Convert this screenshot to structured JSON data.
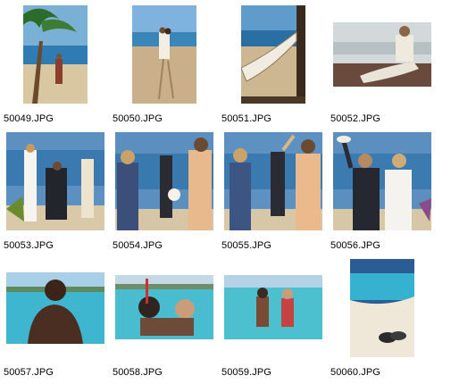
{
  "thumbnails": [
    {
      "filename": "50049.JPG",
      "icon": "palm-tree-beach-couple-photo"
    },
    {
      "filename": "50050.JPG",
      "icon": "couple-walking-beach-photo"
    },
    {
      "filename": "50051.JPG",
      "icon": "hammock-beach-photo"
    },
    {
      "filename": "50052.JPG",
      "icon": "man-reclining-photo"
    },
    {
      "filename": "50053.JPG",
      "icon": "beach-wedding-group-photo"
    },
    {
      "filename": "50054.JPG",
      "icon": "beach-wedding-guests-photo"
    },
    {
      "filename": "50055.JPG",
      "icon": "beach-wedding-celebration-photo"
    },
    {
      "filename": "50056.JPG",
      "icon": "wedding-couple-hat-toss-photo"
    },
    {
      "filename": "50057.JPG",
      "icon": "man-sea-view-photo"
    },
    {
      "filename": "50058.JPG",
      "icon": "snorkeling-couple-photo"
    },
    {
      "filename": "50059.JPG",
      "icon": "snorkel-couple-wading-photo"
    },
    {
      "filename": "50060.JPG",
      "icon": "beach-shore-shoes-photo"
    }
  ]
}
